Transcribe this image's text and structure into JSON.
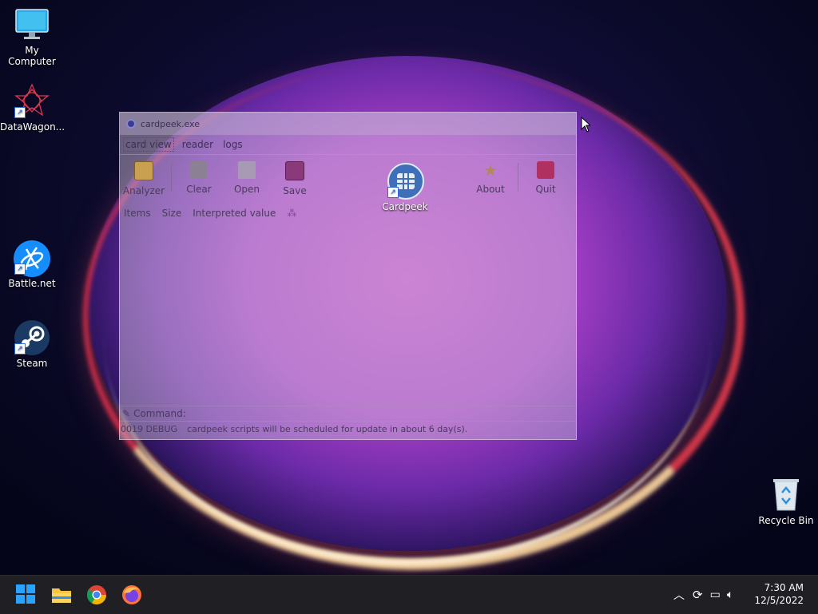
{
  "desktop": {
    "icons": [
      {
        "label": "My Computer"
      },
      {
        "label": "DataWagon..."
      },
      {
        "label": "Battle.net"
      },
      {
        "label": "Steam"
      },
      {
        "label": "Cardpeek"
      },
      {
        "label": "Recycle Bin"
      }
    ]
  },
  "window": {
    "title": "cardpeek.exe",
    "tabs": [
      {
        "label": "card view",
        "active": true
      },
      {
        "label": "reader"
      },
      {
        "label": "logs"
      }
    ],
    "toolbar": {
      "analyzer": "Analyzer",
      "clear": "Clear",
      "open": "Open",
      "save": "Save",
      "about": "About",
      "quit": "Quit"
    },
    "columns": [
      "Items",
      "Size",
      "Interpreted value"
    ],
    "command_label": "Command:",
    "status": {
      "code": "0019 DEBUG",
      "message": "cardpeek scripts will be scheduled for update in about 6 day(s)."
    }
  },
  "taskbar": {
    "time": "7:30 AM",
    "date": "12/5/2022"
  },
  "colors": {
    "taskbar": "#1f1f24",
    "windows_blue": "#29a3ff",
    "folder_yellow": "#f4c542"
  }
}
